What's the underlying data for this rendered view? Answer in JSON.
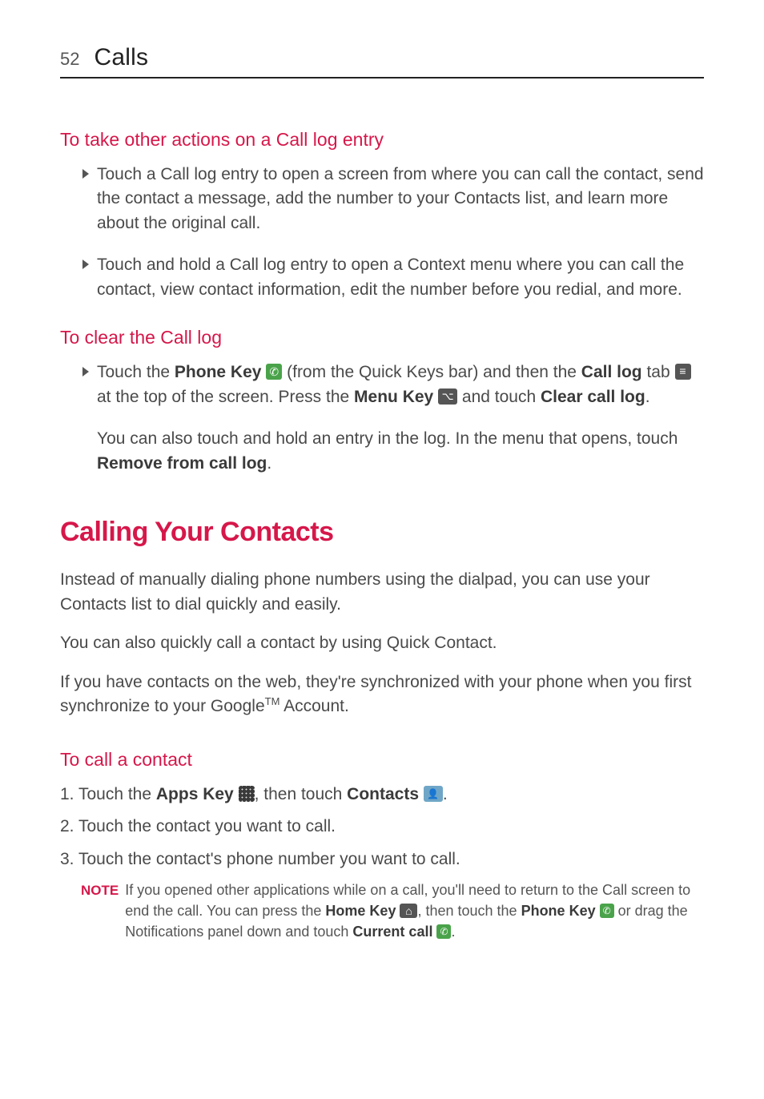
{
  "header": {
    "page_number": "52",
    "section": "Calls"
  },
  "sec1": {
    "heading": "To take other actions on a Call log entry",
    "bullets": [
      "Touch a Call log entry to open a screen from where you can call the contact, send the contact a message, add the number to your Contacts list, and learn more about the original call.",
      "Touch and hold a Call log entry to open a Context menu where you can call the contact, view contact information, edit the number before you redial, and more."
    ]
  },
  "sec2": {
    "heading": "To clear the Call log",
    "b1": {
      "p1a": "Touch the ",
      "pk": "Phone Key",
      "p1b": " (from the Quick Keys bar) and then the ",
      "cl": "Call log",
      "p1c": " tab ",
      "p1d": " at the top of the screen. Press the ",
      "mk": "Menu Key",
      "p1e": " and touch  ",
      "ccl": "Clear call log",
      "p1f": "."
    },
    "b2": {
      "p2a": "You can also touch and hold an entry in the log. In the menu that opens, touch ",
      "rcl": "Remove from call log",
      "p2b": "."
    }
  },
  "main": {
    "heading": "Calling Your Contacts",
    "p1": "Instead of manually dialing phone numbers using the dialpad, you can use your Contacts list to dial quickly and easily.",
    "p2": "You can also quickly call a contact by using Quick Contact.",
    "p3a": "If you have contacts on the web, they're synchronized with your phone when you first synchronize to your Google",
    "p3tm": "TM",
    "p3b": " Account."
  },
  "sec3": {
    "heading": "To call a contact",
    "items": {
      "i1": {
        "num": "1. ",
        "a": "Touch the ",
        "ak": "Apps Key",
        "b": ", then touch ",
        "ct": "Contacts",
        "c": "."
      },
      "i2": {
        "num": "2. ",
        "text": "Touch the contact you want to call."
      },
      "i3": {
        "num": "3. ",
        "text": "Touch the contact's phone number you want to call."
      }
    },
    "note": {
      "label": "NOTE",
      "a": "If you opened other applications while on a call, you'll need to return to the Call screen to end the call. You can press the ",
      "hk": "Home Key",
      "b": ", then touch the ",
      "pk": "Phone Key",
      "c": " or drag the Notifications panel down and touch ",
      "cc": "Current call",
      "d": "."
    }
  }
}
